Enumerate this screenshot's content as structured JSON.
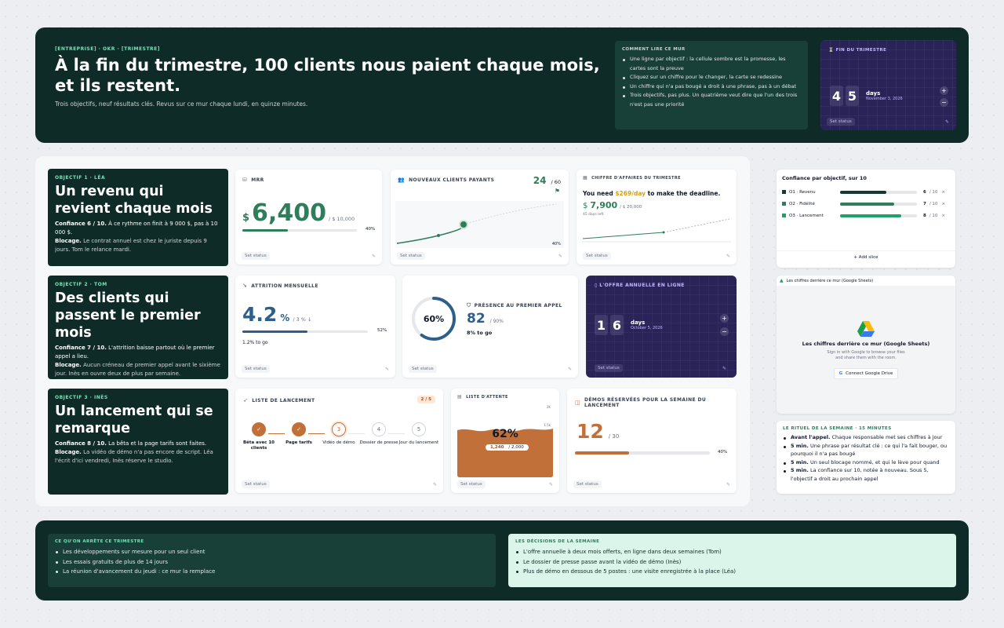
{
  "header": {
    "breadcrumb": "[ENTREPRISE] · OKR · [TRIMESTRE]",
    "title": "À la fin du trimestre, 100 clients nous paient chaque mois, et ils restent.",
    "subtitle": "Trois objectifs, neuf résultats clés. Revus sur ce mur chaque lundi, en quinze minutes.",
    "howto_title": "COMMENT LIRE CE MUR",
    "howto_items": [
      "Une ligne par objectif : la cellule sombre est la promesse, les cartes sont la preuve",
      "Cliquez sur un chiffre pour le changer, la carte se redessine",
      "Un chiffre qui n'a pas bougé a droit à une phrase, pas à un débat",
      "Trois objectifs, pas plus. Un quatrième veut dire que l'un des trois n'est pas une priorité"
    ],
    "countdown": {
      "title": "FIN DU TRIMESTRE",
      "d1": "4",
      "d2": "5",
      "unit": "days",
      "date": "November 3, 2026",
      "plus": "+",
      "minus": "−",
      "status": "Set status",
      "edit": "✎"
    }
  },
  "objectives": [
    {
      "tag": "OBJECTIF 1 · LÉA",
      "title": "Un revenu qui revient chaque mois",
      "conf_label": "Confiance 6 / 10.",
      "conf_text": " À ce rythme on finit à 9 000 $, pas à 10 000 $.",
      "block_label": "Blocage.",
      "block_text": " Le contrat annuel est chez le juriste depuis 9 jours. Tom le relance mardi."
    },
    {
      "tag": "OBJECTIF 2 · TOM",
      "title": "Des clients qui passent le premier mois",
      "conf_label": "Confiance 7 / 10.",
      "conf_text": " L'attrition baisse partout où le premier appel a lieu.",
      "block_label": "Blocage.",
      "block_text": " Aucun créneau de premier appel avant le sixième jour. Inès en ouvre deux de plus par semaine."
    },
    {
      "tag": "OBJECTIF 3 · INÈS",
      "title": "Un lancement qui se remarque",
      "conf_label": "Confiance 8 / 10.",
      "conf_text": " La bêta et la page tarifs sont faites.",
      "block_label": "Blocage.",
      "block_text": " La vidéo de démo n'a pas encore de script. Léa l'écrit d'ici vendredi, Inès réserve le studio."
    }
  ],
  "mrr": {
    "label": "MRR",
    "currency": "$",
    "value": "6,400",
    "target": "/ $ 10,000",
    "pct": "40%",
    "progress": 0.4,
    "status": "Set status",
    "edit": "✎"
  },
  "new_clients": {
    "label": "NOUVEAUX CLIENTS PAYANTS",
    "value": "24",
    "target": "/ 60",
    "pct": "40%",
    "status": "Set status",
    "edit": "✎"
  },
  "quarter_revenue": {
    "label": "CHIFFRE D'AFFAIRES DU TRIMESTRE",
    "need_pre": "You need ",
    "need_amount": "$269/day",
    "need_post": " to make the deadline.",
    "currency": "$",
    "value": "7,900",
    "target": "/ $ 20,000",
    "days_left": "45 days left",
    "status": "Set status",
    "edit": "✎"
  },
  "attrition": {
    "label": "ATTRITION MENSUELLE",
    "value": "4.2",
    "unit": "%",
    "target": "/ 3 % ↓",
    "pct": "52%",
    "progress": 0.52,
    "togo": "1.2% to go",
    "status": "Set status",
    "edit": "✎"
  },
  "first_call": {
    "ring_pct": "60%",
    "ring_value": 0.6,
    "label": "PRÉSENCE AU PREMIER APPEL",
    "value": "82",
    "target": "/ 90%",
    "togo": "8% to go",
    "status": "Set status",
    "edit": "✎"
  },
  "annual_offer": {
    "label": "L'OFFRE ANNUELLE EN LIGNE",
    "d1": "1",
    "d2": "6",
    "unit": "days",
    "date": "October 5, 2026",
    "plus": "+",
    "minus": "−",
    "status": "Set status",
    "edit": "✎"
  },
  "launch_list": {
    "label": "LISTE DE LANCEMENT",
    "badge": "2 / 5",
    "steps": [
      {
        "mark": "✓",
        "label": "Bêta avec 10 clients"
      },
      {
        "mark": "✓",
        "label": "Page tarifs"
      },
      {
        "mark": "3",
        "label": "Vidéo de démo"
      },
      {
        "mark": "4",
        "label": "Dossier de presse"
      },
      {
        "mark": "5",
        "label": "Jour du lancement"
      }
    ],
    "status": "Set status",
    "edit": "✎"
  },
  "waitlist": {
    "label": "LISTE D'ATTENTE",
    "pct": "62%",
    "value": "1,240",
    "target": "/ 2,000",
    "fill": 0.62,
    "ticks": [
      "2K",
      "1.5k",
      "1k",
      "500"
    ],
    "status": "Set status",
    "edit": "✎"
  },
  "demos": {
    "label": "DÉMOS RÉSERVÉES POUR LA SEMAINE DU LANCEMENT",
    "value": "12",
    "target": "/ 30",
    "pct": "40%",
    "progress": 0.4,
    "status": "Set status",
    "edit": "✎"
  },
  "confidence": {
    "title": "Confiance par objectif, sur 10",
    "rows": [
      {
        "label": "O1 · Revenu",
        "value": "6",
        "max": "/ 10",
        "score": 6,
        "color": "#163a33"
      },
      {
        "label": "O2 · Fidélité",
        "value": "7",
        "max": "/ 10",
        "score": 7,
        "color": "#2e7d5b"
      },
      {
        "label": "O3 · Lancement",
        "value": "8",
        "max": "/ 10",
        "score": 8,
        "color": "#22a06b"
      }
    ],
    "remove": "×",
    "add": "+ Add slice"
  },
  "sheets": {
    "tab": "Les chiffres derrière ce mur (Google Sheets)",
    "title": "Les chiffres derrière ce mur (Google Sheets)",
    "desc": "Sign in with Google to browse your files and share them with the room.",
    "button": "Connect Google Drive",
    "g": "G"
  },
  "ritual": {
    "title": "LE RITUEL DE LA SEMAINE · 15 MINUTES",
    "items": [
      {
        "b": "Avant l'appel.",
        "t": " Chaque responsable met ses chiffres à jour"
      },
      {
        "b": "5 min.",
        "t": " Une phrase par résultat clé : ce qui l'a fait bouger, ou pourquoi il n'a pas bougé"
      },
      {
        "b": "5 min.",
        "t": " Un seul blocage nommé, et qui le lève pour quand"
      },
      {
        "b": "5 min.",
        "t": " La confiance sur 10, notée à nouveau. Sous 5, l'objectif a droit au prochain appel"
      }
    ]
  },
  "stop": {
    "title": "CE QU'ON ARRÊTE CE TRIMESTRE",
    "items": [
      "Les développements sur mesure pour un seul client",
      "Les essais gratuits de plus de 14 jours",
      "La réunion d'avancement du jeudi : ce mur la remplace"
    ]
  },
  "decisions": {
    "title": "LES DÉCISIONS DE LA SEMAINE",
    "items": [
      "L'offre annuelle à deux mois offerts, en ligne dans deux semaines (Tom)",
      "Le dossier de presse passe avant la vidéo de démo (Inès)",
      "Plus de démo en dessous de 5 postes : une visite enregistrée à la place (Léa)"
    ]
  }
}
